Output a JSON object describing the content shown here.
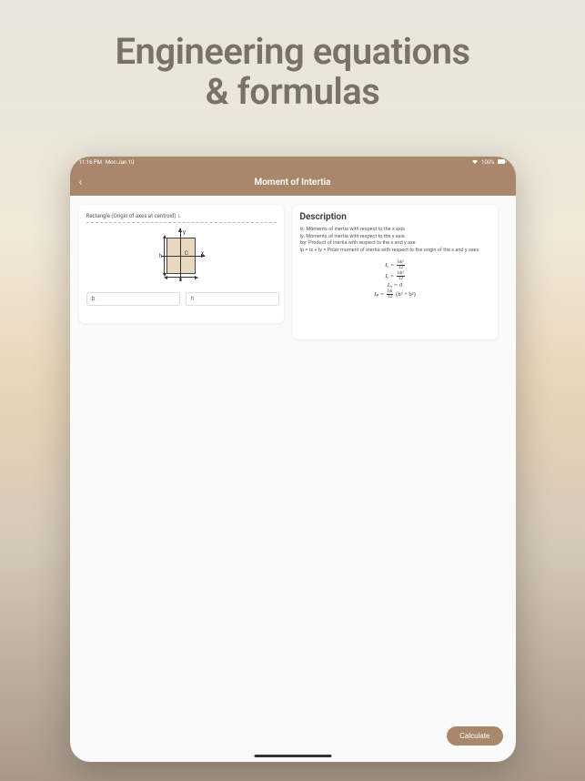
{
  "hero": {
    "line1": "Engineering equations",
    "line2": "& formulas"
  },
  "status": {
    "time": "11:16 PM",
    "date": "Mon Jan 10",
    "battery": "100%"
  },
  "header": {
    "title": "Moment of Intertia"
  },
  "shape_panel": {
    "dropdown_label": "Rectangle (Origin of axes at centroid)",
    "diagram_labels": {
      "y": "y",
      "x": "x",
      "h": "h",
      "b": "b",
      "c": "C"
    },
    "inputs": {
      "b_placeholder": "b",
      "h_placeholder": "h"
    }
  },
  "description_panel": {
    "title": "Description",
    "lines": [
      "Ix: Moments of inertia with respect to the x axis",
      "Iy: Moments of inertia with respect to the y axis",
      "Ixy: Product of inertia with respect to the x and y axe",
      "Ip = Ix + Iy = Polar moment of inertia with respect to the origin of the x and y axes"
    ],
    "formulas": {
      "ix_lhs": "Iₓ =",
      "ix_num": "bh³",
      "ix_den": "12",
      "iy_lhs": "Iᵧ =",
      "iy_num": "hb³",
      "iy_den": "12",
      "ixy": "Iₓᵧ = 0",
      "ip_lhs": "Iₚ =",
      "ip_num": "bh",
      "ip_den": "12",
      "ip_tail": "(h² + b²)"
    }
  },
  "calculate_button": "Calculate"
}
